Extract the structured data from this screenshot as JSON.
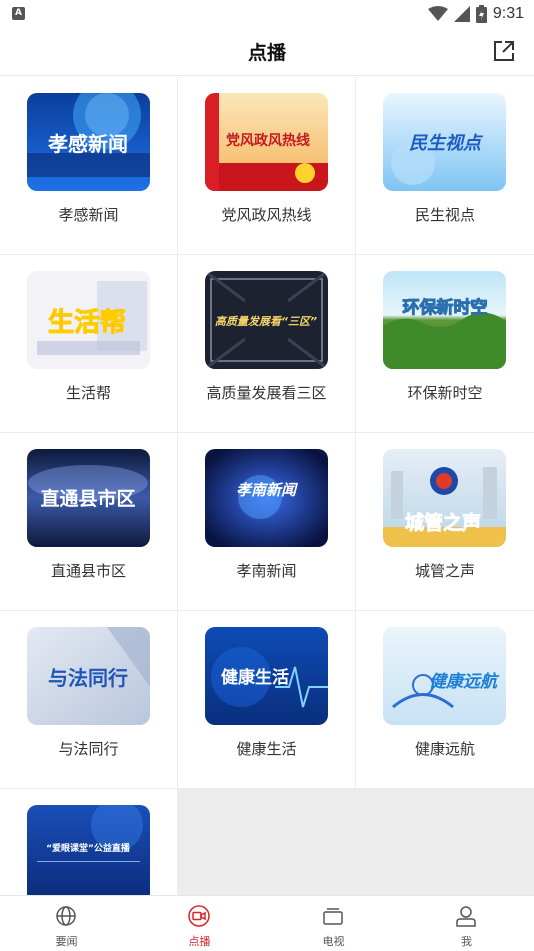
{
  "status_bar": {
    "time": "9:31",
    "notification_badge": "A"
  },
  "header": {
    "title": "点播"
  },
  "programs": [
    {
      "label": "孝感新闻",
      "thumb_text": "孝感新闻"
    },
    {
      "label": "党风政风热线",
      "thumb_text": "党风政风热线"
    },
    {
      "label": "民生视点",
      "thumb_text": "民生视点"
    },
    {
      "label": "生活帮",
      "thumb_text": "生活帮"
    },
    {
      "label": "高质量发展看三区",
      "thumb_text": "高质量发展看“三区”"
    },
    {
      "label": "环保新时空",
      "thumb_text": "环保新时空"
    },
    {
      "label": "直通县市区",
      "thumb_text": "直通县市区"
    },
    {
      "label": "孝南新闻",
      "thumb_text": "孝南新闻"
    },
    {
      "label": "城管之声",
      "thumb_text": "城管之声"
    },
    {
      "label": "与法同行",
      "thumb_text": "与法同行"
    },
    {
      "label": "健康生活",
      "thumb_text": "健康生活"
    },
    {
      "label": "健康远航",
      "thumb_text": "健康远航"
    },
    {
      "label": "",
      "thumb_text": "“爱眼课堂”公益直播"
    }
  ],
  "bottom_nav": [
    {
      "label": "要闻",
      "icon": "globe-icon",
      "active": false
    },
    {
      "label": "点播",
      "icon": "video-icon",
      "active": true
    },
    {
      "label": "电视",
      "icon": "tv-icon",
      "active": false
    },
    {
      "label": "我",
      "icon": "user-icon",
      "active": false
    }
  ],
  "colors": {
    "accent": "#d9252a",
    "divider": "#ececec"
  }
}
